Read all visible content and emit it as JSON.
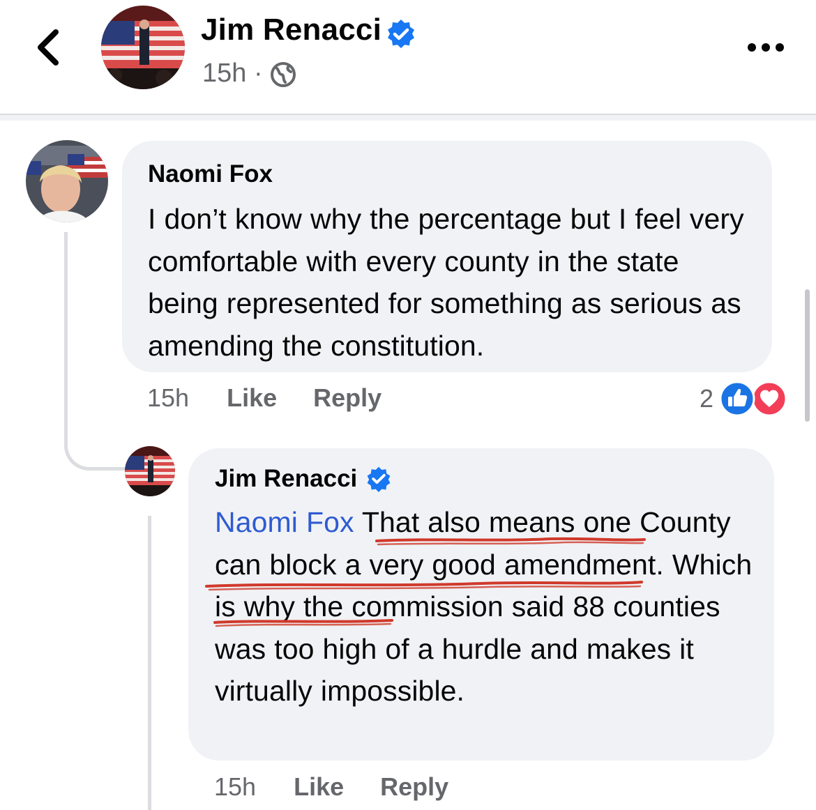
{
  "header": {
    "name": "Jim Renacci",
    "time": "15h",
    "dot": "·",
    "privacy_icon": "globe-icon",
    "back_icon": "chevron-left-icon",
    "more_icon": "more-horizontal-icon"
  },
  "comments": [
    {
      "author": "Naomi Fox",
      "text": "I don’t know why the percentage but I feel very comfortable with every county in the state being represented for something as serious as amending the constitution.",
      "time": "15h",
      "like_label": "Like",
      "reply_label": "Reply",
      "reaction_count": "2",
      "reaction_icons": [
        "like-reaction-icon",
        "love-reaction-icon"
      ]
    },
    {
      "author": "Jim Renacci",
      "verified": true,
      "mention": "Naomi Fox",
      "text": " That also means one County can block a very good amendment.  Which is why the commission said 88 counties was too high of a hurdle and makes it virtually impossible.",
      "time": "15h",
      "like_label": "Like",
      "reply_label": "Reply"
    }
  ],
  "colors": {
    "bubble": "#f0f2f5",
    "secondary_text": "#65676b",
    "verified_badge": "#1877f2",
    "mention": "#2f5bd1",
    "annotation": "#d0392b",
    "like_blue": "#1b74e4",
    "love_red": "#f33e58"
  }
}
